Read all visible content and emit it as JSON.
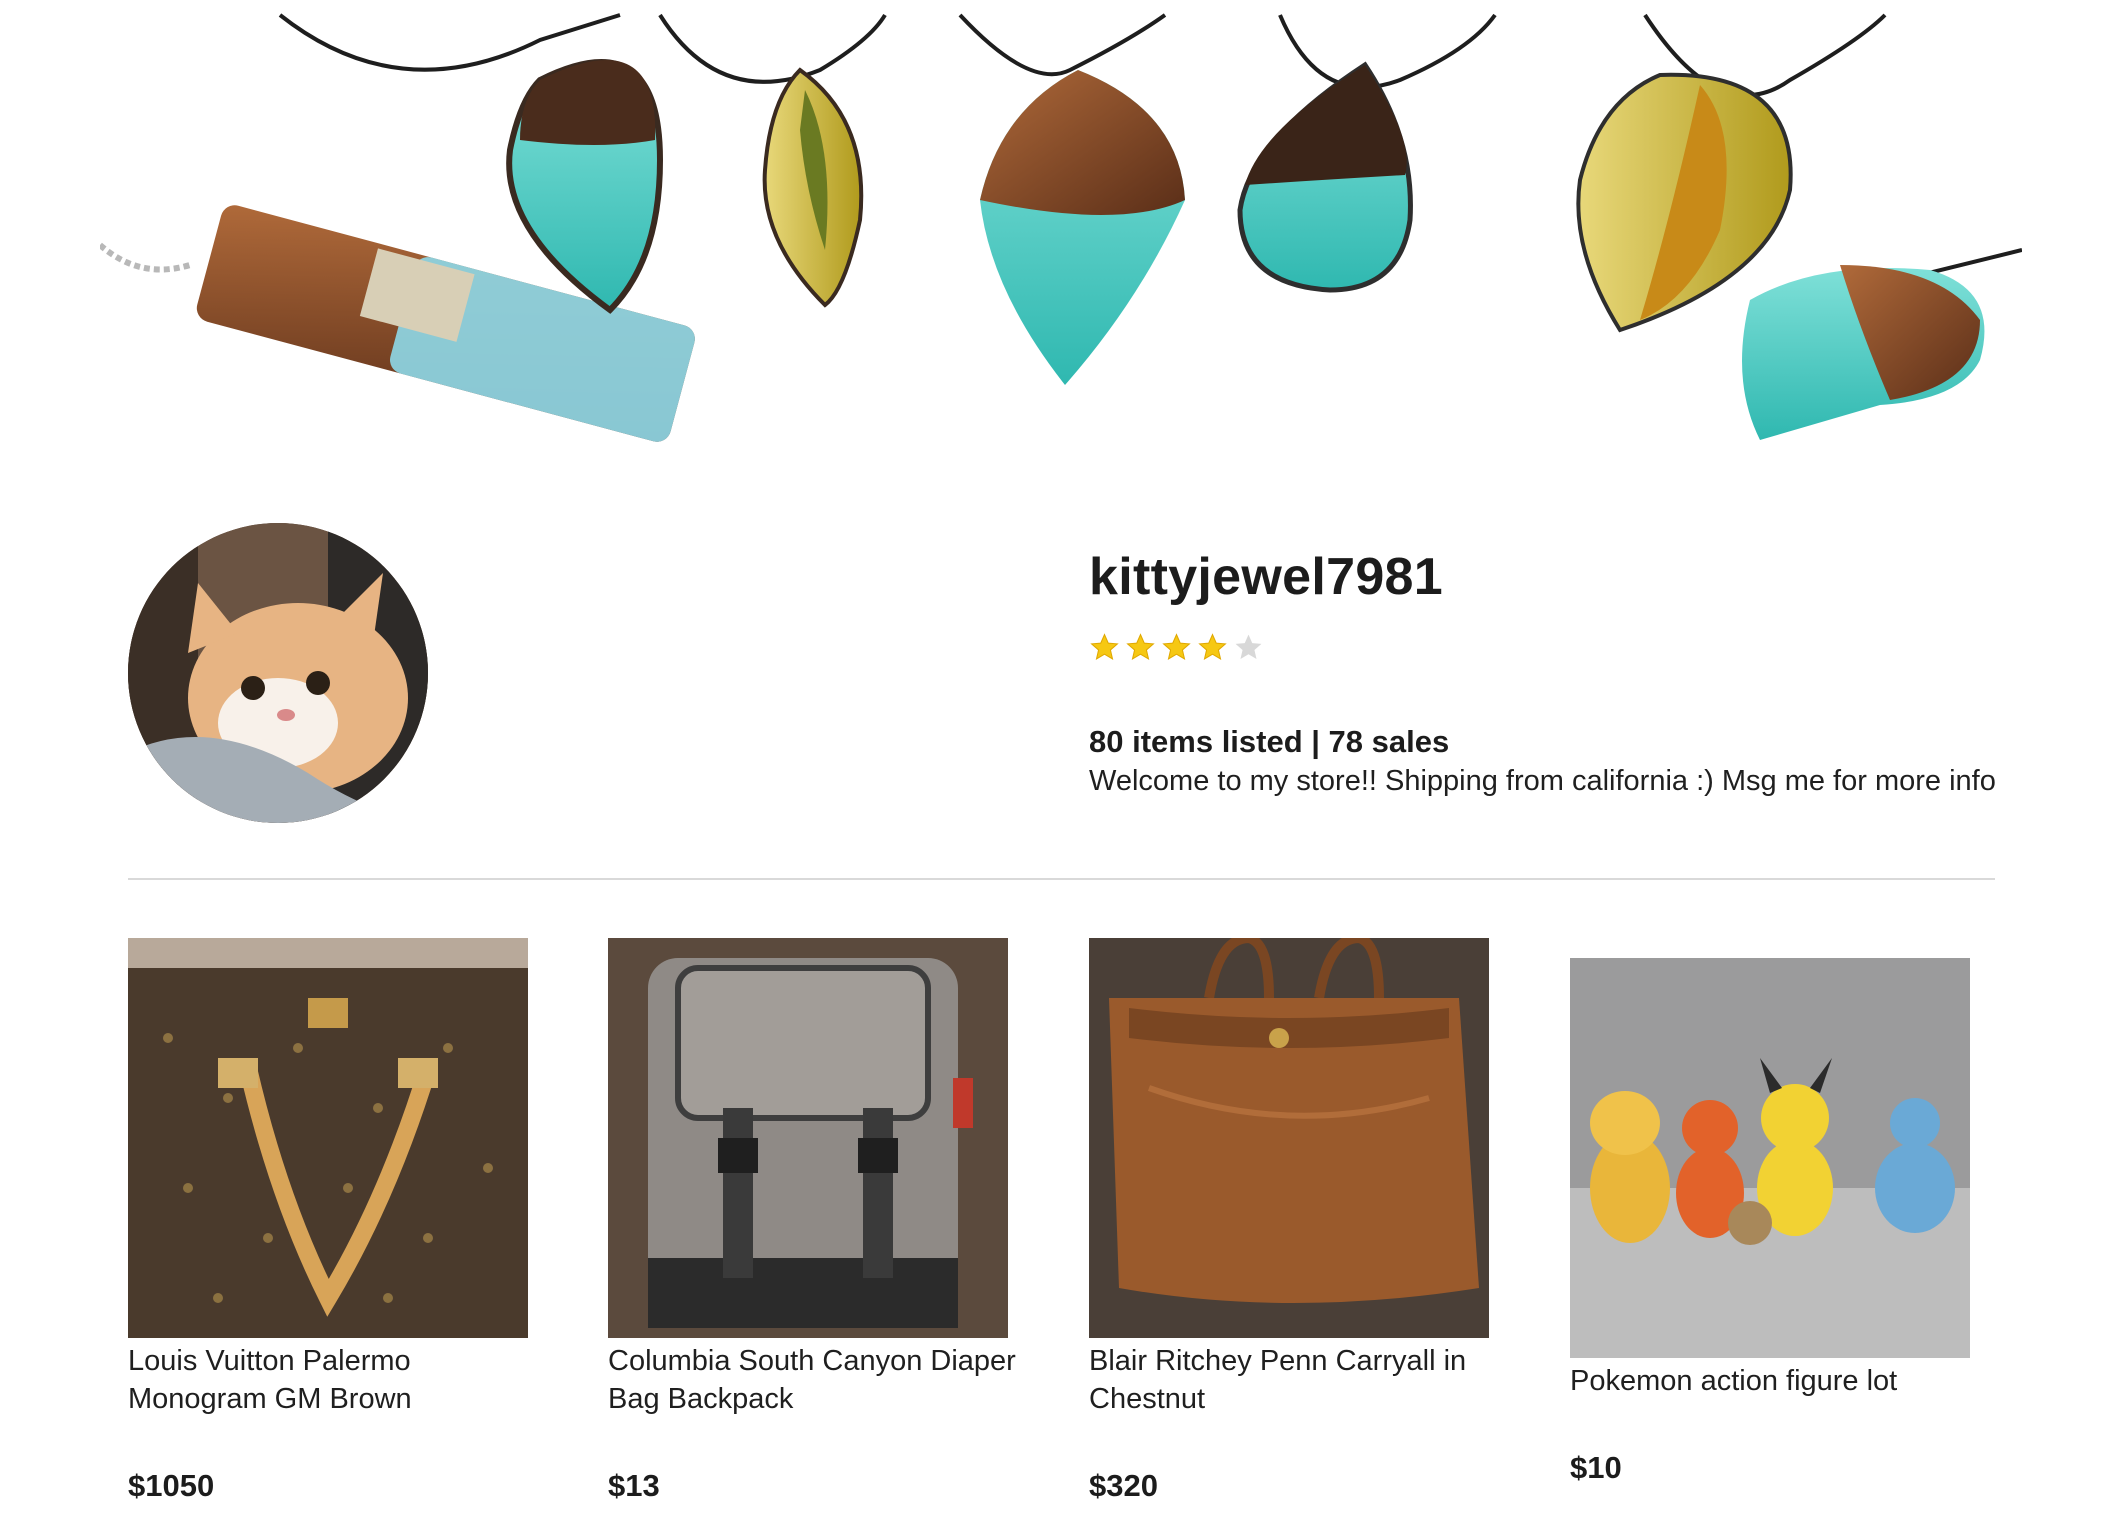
{
  "banner": {
    "alt": "resin wood jewelry pendants"
  },
  "shop": {
    "name": "kittyjewel7981",
    "rating": 4,
    "rating_max": 5,
    "stats": "80 items listed | 78 sales",
    "description": "Welcome to my store!! Shipping from california :) Msg me for more info"
  },
  "colors": {
    "star_filled": "#f6c813",
    "star_empty": "#d8d8d8",
    "divider": "#d9d9d9"
  },
  "listings": [
    {
      "title": "Louis Vuitton Palermo Monogram GM Brown",
      "price": "$1050"
    },
    {
      "title": "Columbia South Canyon Diaper Bag Backpack",
      "price": "$13"
    },
    {
      "title": "Blair Ritchey Penn Carryall in Chestnut",
      "price": "$320"
    },
    {
      "title": "Pokemon action figure lot",
      "price": "$10"
    }
  ]
}
